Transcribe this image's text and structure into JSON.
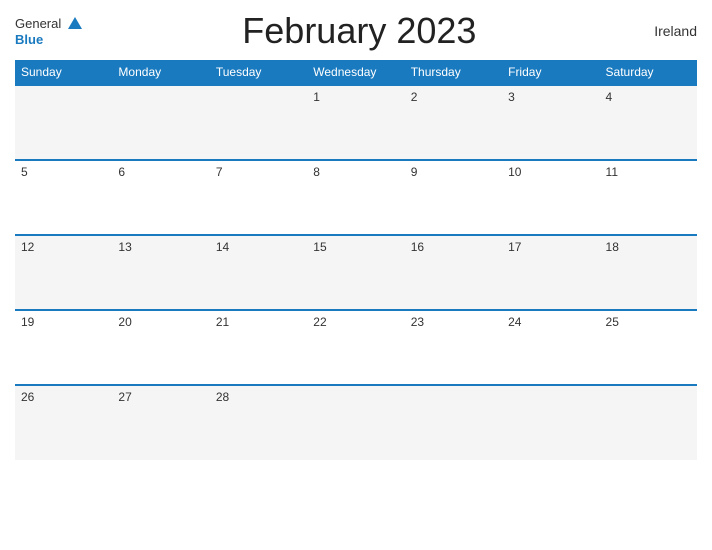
{
  "header": {
    "logo_general": "General",
    "logo_blue": "Blue",
    "title": "February 2023",
    "country": "Ireland"
  },
  "days_of_week": [
    "Sunday",
    "Monday",
    "Tuesday",
    "Wednesday",
    "Thursday",
    "Friday",
    "Saturday"
  ],
  "weeks": [
    [
      "",
      "",
      "",
      "1",
      "2",
      "3",
      "4"
    ],
    [
      "5",
      "6",
      "7",
      "8",
      "9",
      "10",
      "11"
    ],
    [
      "12",
      "13",
      "14",
      "15",
      "16",
      "17",
      "18"
    ],
    [
      "19",
      "20",
      "21",
      "22",
      "23",
      "24",
      "25"
    ],
    [
      "26",
      "27",
      "28",
      "",
      "",
      "",
      ""
    ]
  ]
}
